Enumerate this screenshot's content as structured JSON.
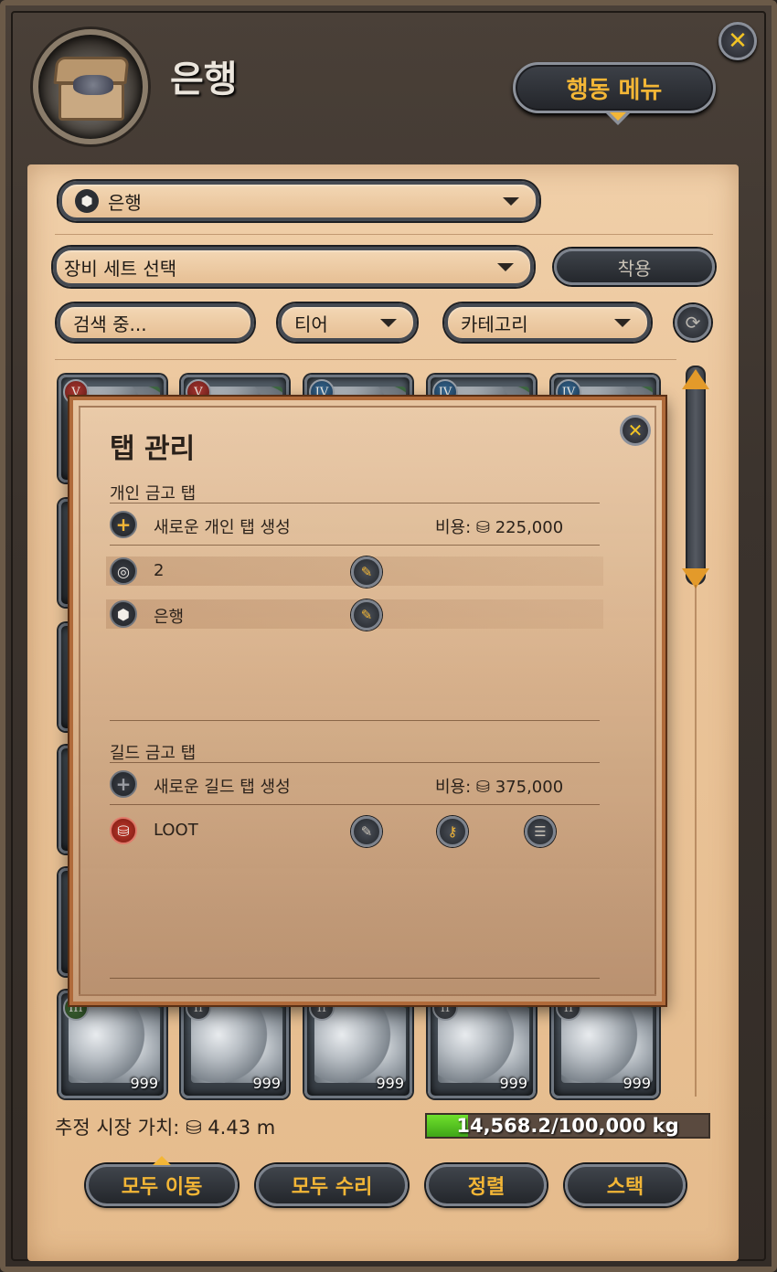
{
  "window": {
    "title": "은행",
    "close_icon": "✕",
    "action_menu_label": "행동 메뉴"
  },
  "filters": {
    "bank_dropdown": "은행",
    "equipment_set": "장비 세트 선택",
    "apply_label": "착용",
    "search_placeholder": "검색 중...",
    "tier_label": "티어",
    "category_label": "카테고리"
  },
  "inventory": {
    "top_row": [
      {
        "tier": "V",
        "tier_color": "#b23a33"
      },
      {
        "tier": "V",
        "tier_color": "#b23a33"
      },
      {
        "tier": "IV",
        "tier_color": "#3b6f9a"
      },
      {
        "tier": "IV",
        "tier_color": "#3b6f9a"
      },
      {
        "tier": "IV",
        "tier_color": "#3b6f9a"
      }
    ],
    "bottom_row": [
      {
        "tier": "III",
        "qty": "999"
      },
      {
        "tier": "II",
        "qty": "999"
      },
      {
        "tier": "II",
        "qty": "999"
      },
      {
        "tier": "II",
        "qty": "999"
      },
      {
        "tier": "II",
        "qty": "999"
      }
    ]
  },
  "footer": {
    "market_value": "추정 시장 가치: ⛁ 4.43 m",
    "weight_text": "14,568.2/100,000 kg",
    "weight_fraction": 0.146,
    "buttons": {
      "move_all": "모두 이동",
      "repair_all": "모두 수리",
      "sort": "정렬",
      "stack": "스택"
    }
  },
  "popup": {
    "title": "탭 관리",
    "personal_section": "개인 금고 탭",
    "create_personal": "새로운 개인 탭 생성",
    "personal_cost": "비용: ⛁ 225,000",
    "personal_tabs": [
      {
        "label": "2",
        "icon": "target-icon"
      },
      {
        "label": "은행",
        "icon": "box-icon"
      }
    ],
    "guild_section": "길드 금고 탭",
    "create_guild": "새로운 길드 탭 생성",
    "guild_cost": "비용: ⛁ 375,000",
    "guild_tabs": [
      {
        "label": "LOOT",
        "icon": "coins-icon"
      }
    ]
  },
  "colors": {
    "accent_gold": "#f3b636",
    "weight_green": "#5ed024",
    "parchment": "#eac49a"
  }
}
